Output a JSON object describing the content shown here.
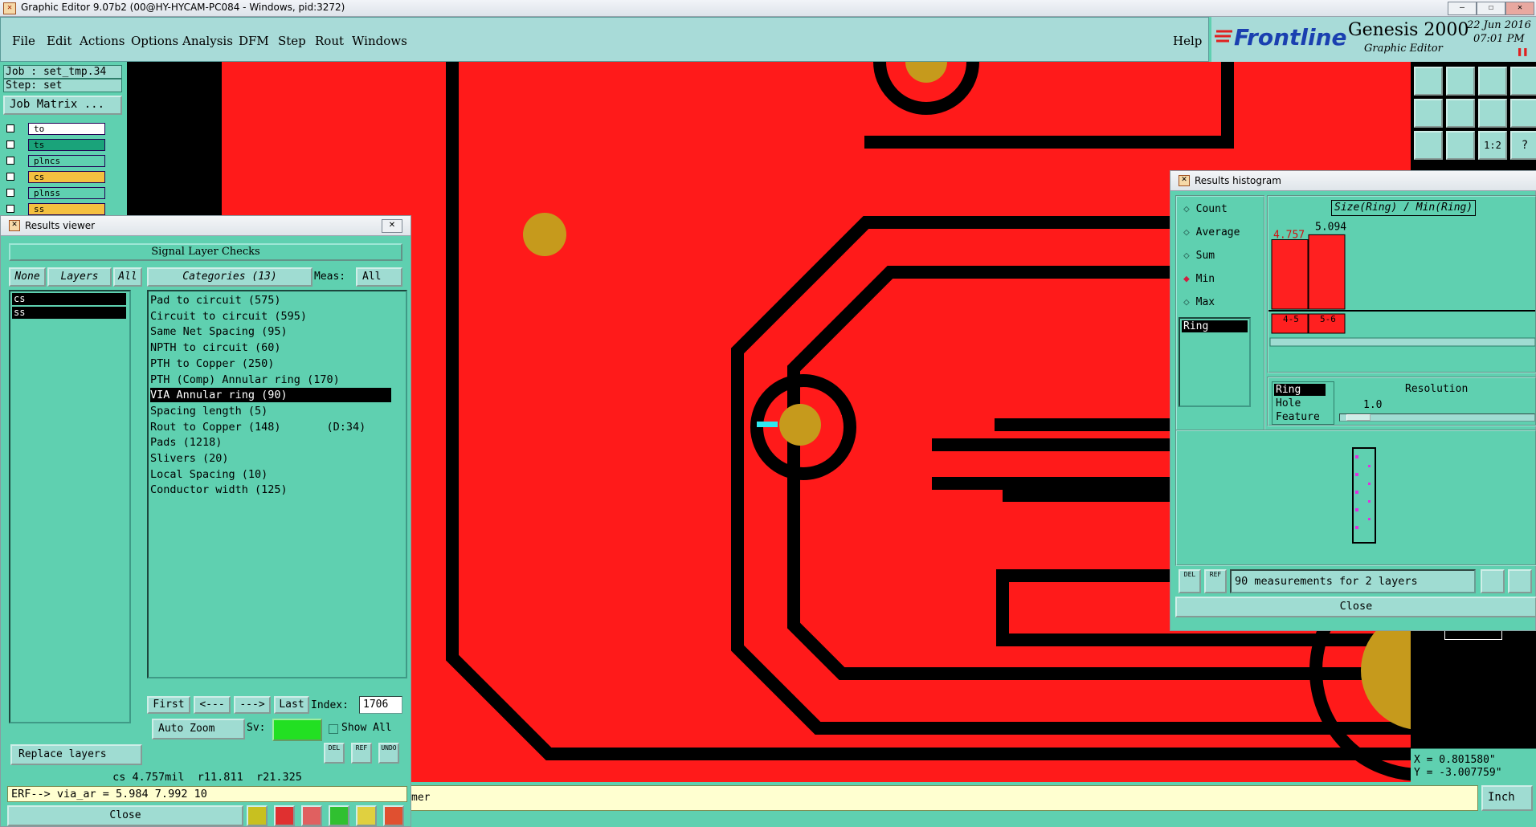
{
  "window": {
    "title": "Graphic Editor 9.07b2 (00@HY-HYCAM-PC084 - Windows, pid:3272)"
  },
  "menu": [
    "File",
    "Edit",
    "Actions",
    "Options",
    "Analysis",
    "DFM",
    "Step",
    "Rout",
    "Windows"
  ],
  "help_label": "Help",
  "brand": {
    "logo": "Frontline",
    "product": "Genesis 2000",
    "subtitle": "Graphic Editor",
    "date": "22 Jun 2016",
    "time": "07:01 PM"
  },
  "job": {
    "job_line": "Job : set_tmp.34",
    "step_line": "Step: set",
    "matrix_button": "Job Matrix ..."
  },
  "layers": [
    {
      "name": "to",
      "color": "#ffffff"
    },
    {
      "name": "ts",
      "color": "#1aa37a"
    },
    {
      "name": "plncs",
      "color": "#5fd0b0"
    },
    {
      "name": "cs",
      "color": "#f4c040"
    },
    {
      "name": "plnss",
      "color": "#5fd0b0"
    },
    {
      "name": "ss",
      "color": "#f4c040"
    }
  ],
  "results_viewer": {
    "title": "Results viewer",
    "header": "Signal Layer Checks",
    "none_btn": "None",
    "layers_btn": "Layers",
    "all_btn": "All",
    "categories_btn": "Categories (13)",
    "meas_label": "Meas:",
    "meas_value": "All",
    "layer_list": [
      "cs",
      "ss"
    ],
    "categories": [
      "Pad to circuit (575)",
      "Circuit to circuit (595)",
      "Same Net Spacing (95)",
      "NPTH to circuit (60)",
      "PTH to Copper (250)",
      "PTH (Comp) Annular ring (170)",
      "VIA Annular ring (90)",
      "Spacing length (5)",
      "Rout to Copper (148)       (D:34)",
      "Pads (1218)",
      "Slivers (20)",
      "Local Spacing (10)",
      "Conductor width (125)"
    ],
    "selected_index": 6,
    "first_btn": "First",
    "prev_btn": "<---",
    "next_btn": "--->",
    "last_btn": "Last",
    "index_label": "Index:",
    "index_value": "1706",
    "auto_zoom": "Auto Zoom",
    "sv_label": "Sv:",
    "show_all": "Show All",
    "replace_layers": "Replace layers",
    "del": "DEL",
    "ref": "REF",
    "undo": "UNDO",
    "measure_line": "cs 4.757mil  r11.811  r21.325",
    "erf_line": "ERF--> via_ar = 5.984 7.992 10",
    "close": "Close"
  },
  "histogram": {
    "title": "Results histogram",
    "chart_title": "Size(Ring) / Min(Ring)",
    "stats": [
      "Count",
      "Average",
      "Sum",
      "Min",
      "Max"
    ],
    "selected_stat": "Min",
    "list_item": "Ring",
    "ring_options": [
      "Ring",
      "Hole",
      "Feature"
    ],
    "resolution_label": "Resolution",
    "resolution_value": "1.0",
    "status": "90 measurements for 2 layers",
    "del": "DEL",
    "ref": "REF",
    "close": "Close",
    "bar_values": [
      "4.757",
      "5.094"
    ],
    "bar_bins": [
      "4-\n5",
      "5-\n6"
    ]
  },
  "coords": {
    "x": "X =  0.801580\"",
    "y": "Y = -3.007759\""
  },
  "status_text": "mer",
  "units": "Inch",
  "chart_data": {
    "type": "bar",
    "title": "Size(Ring) / Min(Ring)",
    "categories": [
      "4-5",
      "5-6"
    ],
    "values": [
      4.757,
      5.094
    ]
  }
}
